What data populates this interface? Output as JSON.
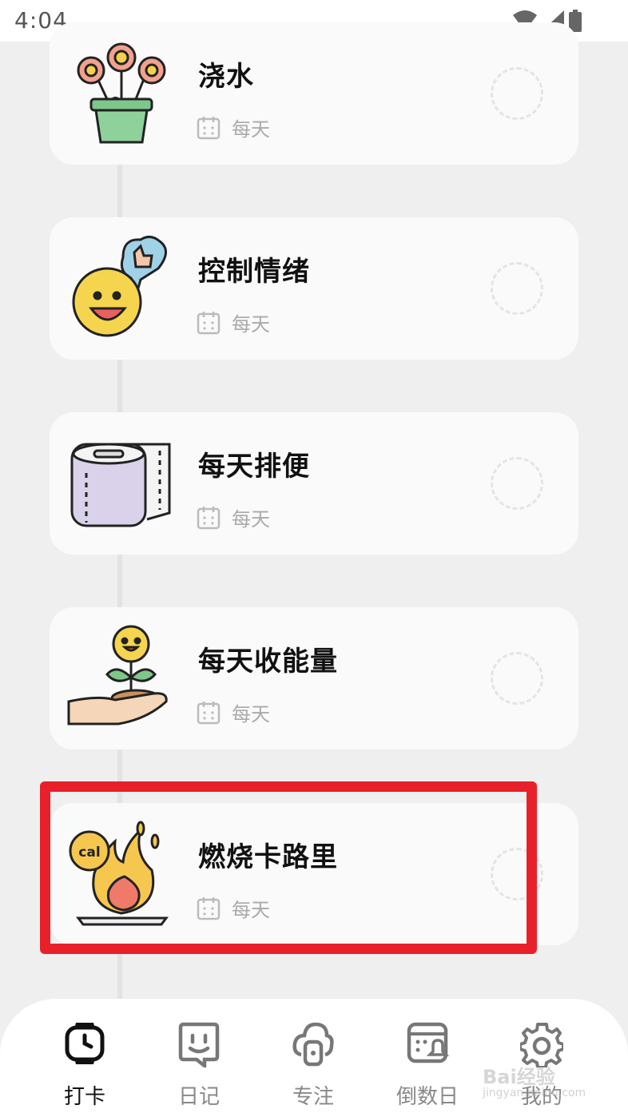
{
  "status_bar": {
    "time": "4:04"
  },
  "habits": [
    {
      "title": "浇水",
      "frequency": "每天",
      "icon": "flower-pot-icon"
    },
    {
      "title": "控制情绪",
      "frequency": "每天",
      "icon": "smiley-heart-icon"
    },
    {
      "title": "每天排便",
      "frequency": "每天",
      "icon": "toilet-paper-icon"
    },
    {
      "title": "每天收能量",
      "frequency": "每天",
      "icon": "sprout-hand-icon"
    },
    {
      "title": "燃烧卡路里",
      "frequency": "每天",
      "icon": "calorie-fire-icon",
      "cal_text": "cal"
    }
  ],
  "nav": [
    {
      "label": "打卡",
      "icon": "watch-icon",
      "active": true
    },
    {
      "label": "日记",
      "icon": "diary-face-icon",
      "active": false
    },
    {
      "label": "专注",
      "icon": "focus-lock-icon",
      "active": false
    },
    {
      "label": "倒数日",
      "icon": "countdown-calendar-icon",
      "active": false
    },
    {
      "label": "我的",
      "icon": "gear-icon",
      "active": false
    }
  ],
  "colors": {
    "highlight": "#e8202a",
    "background": "#efefef",
    "card": "#fafafa"
  },
  "watermark": {
    "text": "Bai经验",
    "sub": "jingyan.baidu.com"
  }
}
